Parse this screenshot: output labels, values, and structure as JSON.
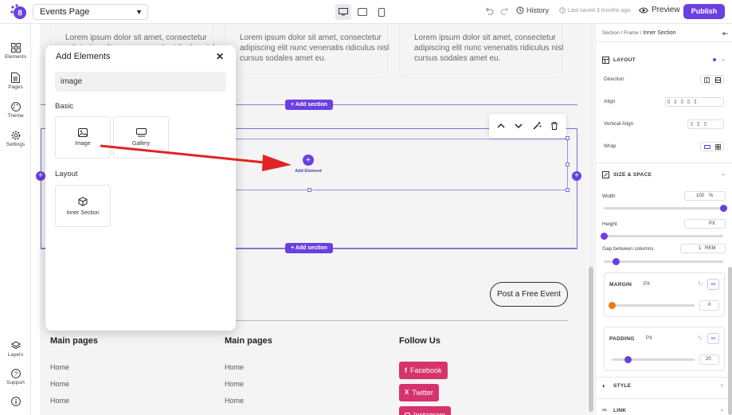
{
  "topbar": {
    "page_select": "Events Page",
    "history": "History",
    "saved": "Last saved 3 months ago",
    "preview": "Preview",
    "publish": "Publish"
  },
  "rail": {
    "items": [
      {
        "label": "Elements",
        "icon": "grid-icon"
      },
      {
        "label": "Pages",
        "icon": "document-icon"
      },
      {
        "label": "Theme",
        "icon": "palette-icon"
      },
      {
        "label": "Settings",
        "icon": "gear-icon"
      }
    ],
    "bottom": [
      {
        "label": "Layers",
        "icon": "layers-icon"
      },
      {
        "label": "Support",
        "icon": "help-icon"
      }
    ]
  },
  "canvas": {
    "lorem": "Lorem ipsum dolor sit amet, consectetur adipiscing elit nunc venenatis ridiculus nisl cursus sodales amet eu.",
    "add_section": "+ Add section",
    "add_element": "Add Element",
    "post_event": "Post a Free Event",
    "footer_cols": [
      {
        "heading": "Main pages",
        "items": [
          "Home",
          "Home",
          "Home"
        ]
      },
      {
        "heading": "Main pages",
        "items": [
          "Home",
          "Home",
          "Home"
        ]
      },
      {
        "heading": "Follow Us",
        "items": [
          "Facebook",
          "Twitter",
          "Instagram"
        ]
      }
    ]
  },
  "panel": {
    "title": "Add Elements",
    "search_value": "image",
    "groups": [
      {
        "label": "Basic",
        "tiles": [
          "Image",
          "Gallery"
        ]
      },
      {
        "label": "Layout",
        "tiles": [
          "Inner Section"
        ]
      }
    ]
  },
  "inspector": {
    "breadcrumb": [
      "Section",
      "Frame",
      "Inner Section"
    ],
    "layout_title": "LAYOUT",
    "direction": "Direction",
    "align": "Align",
    "vertical_align": "Vertical Align",
    "wrap": "Wrap",
    "size_title": "SIZE & SPACE",
    "width": {
      "label": "Width",
      "value": "100",
      "unit": "%",
      "level": 1.0
    },
    "height": {
      "label": "Height",
      "unit": "PX",
      "level": 0.0
    },
    "gap": {
      "label": "Gap between columns",
      "value": "1",
      "unit": "REM",
      "level": 0.1
    },
    "margin": {
      "label": "MARGIN",
      "unit": "PX",
      "value": "0",
      "level": 0.0
    },
    "padding": {
      "label": "PADDING",
      "unit": "PX",
      "value": "20",
      "level": 0.2
    },
    "style": "STYLE",
    "link": "LINK"
  },
  "colors": {
    "accent": "#6b3fe0",
    "arrow": "#e02424",
    "social": "#d6336c"
  }
}
